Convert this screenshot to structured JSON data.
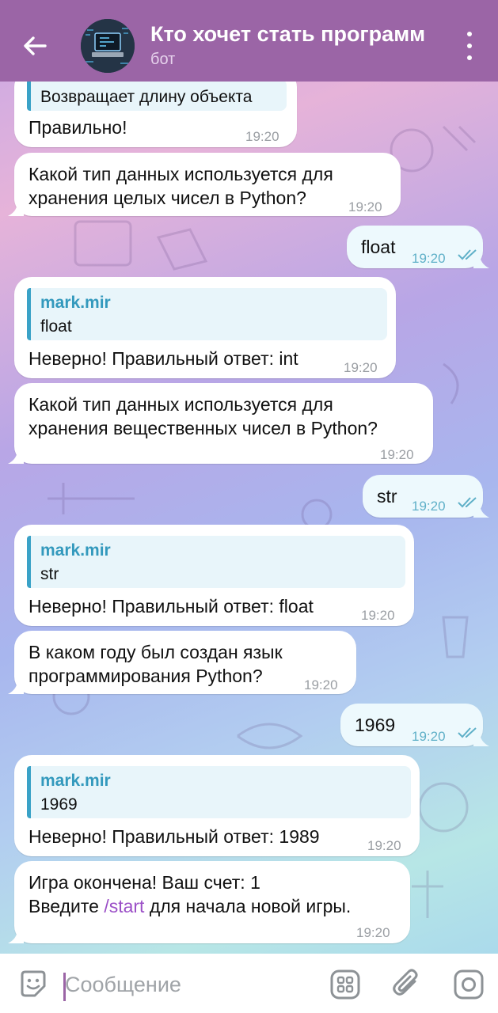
{
  "header": {
    "title": "Кто хочет стать программ",
    "subtitle": "бот"
  },
  "messages": {
    "m0": {
      "quote_text": "Возвращает длину объекта",
      "text": "Правильно!",
      "time": "19:20"
    },
    "m1": {
      "line1": "Какой тип данных используется для",
      "line2": "хранения целых чисел в Python?",
      "time": "19:20"
    },
    "m2": {
      "text": "float",
      "time": "19:20"
    },
    "m3": {
      "quote_name": "mark.mir",
      "quote_text": "float",
      "text": "Неверно! Правильный ответ: int",
      "time": "19:20"
    },
    "m4": {
      "line1": "Какой тип данных используется для",
      "line2": "хранения вещественных чисел в Python?",
      "time": "19:20"
    },
    "m5": {
      "text": "str",
      "time": "19:20"
    },
    "m6": {
      "quote_name": "mark.mir",
      "quote_text": "str",
      "text": "Неверно! Правильный ответ: float",
      "time": "19:20"
    },
    "m7": {
      "line1": "В каком году был создан язык",
      "line2": "программирования Python?",
      "time": "19:20"
    },
    "m8": {
      "text": "1969",
      "time": "19:20"
    },
    "m9": {
      "quote_name": "mark.mir",
      "quote_text": "1969",
      "text": "Неверно! Правильный ответ: 1989",
      "time": "19:20"
    },
    "m10": {
      "line1": "Игра окончена! Ваш счет: 1",
      "line2_pre": "Введите ",
      "line2_cmd": "/start",
      "line2_post": " для начала новой игры.",
      "time": "19:20"
    }
  },
  "input": {
    "placeholder": "Сообщение"
  },
  "icons": {
    "back": "arrow-left-icon",
    "menu": "more-vertical-icon",
    "emoji": "emoji-icon",
    "bot_commands": "bot-commands-icon",
    "attach": "paperclip-icon",
    "camera": "camera-icon"
  },
  "colors": {
    "header": "#9b65a6",
    "outgoing_bubble": "#edf9fd",
    "quote_accent": "#3aa2c7",
    "command_link": "#9b4fc7"
  }
}
